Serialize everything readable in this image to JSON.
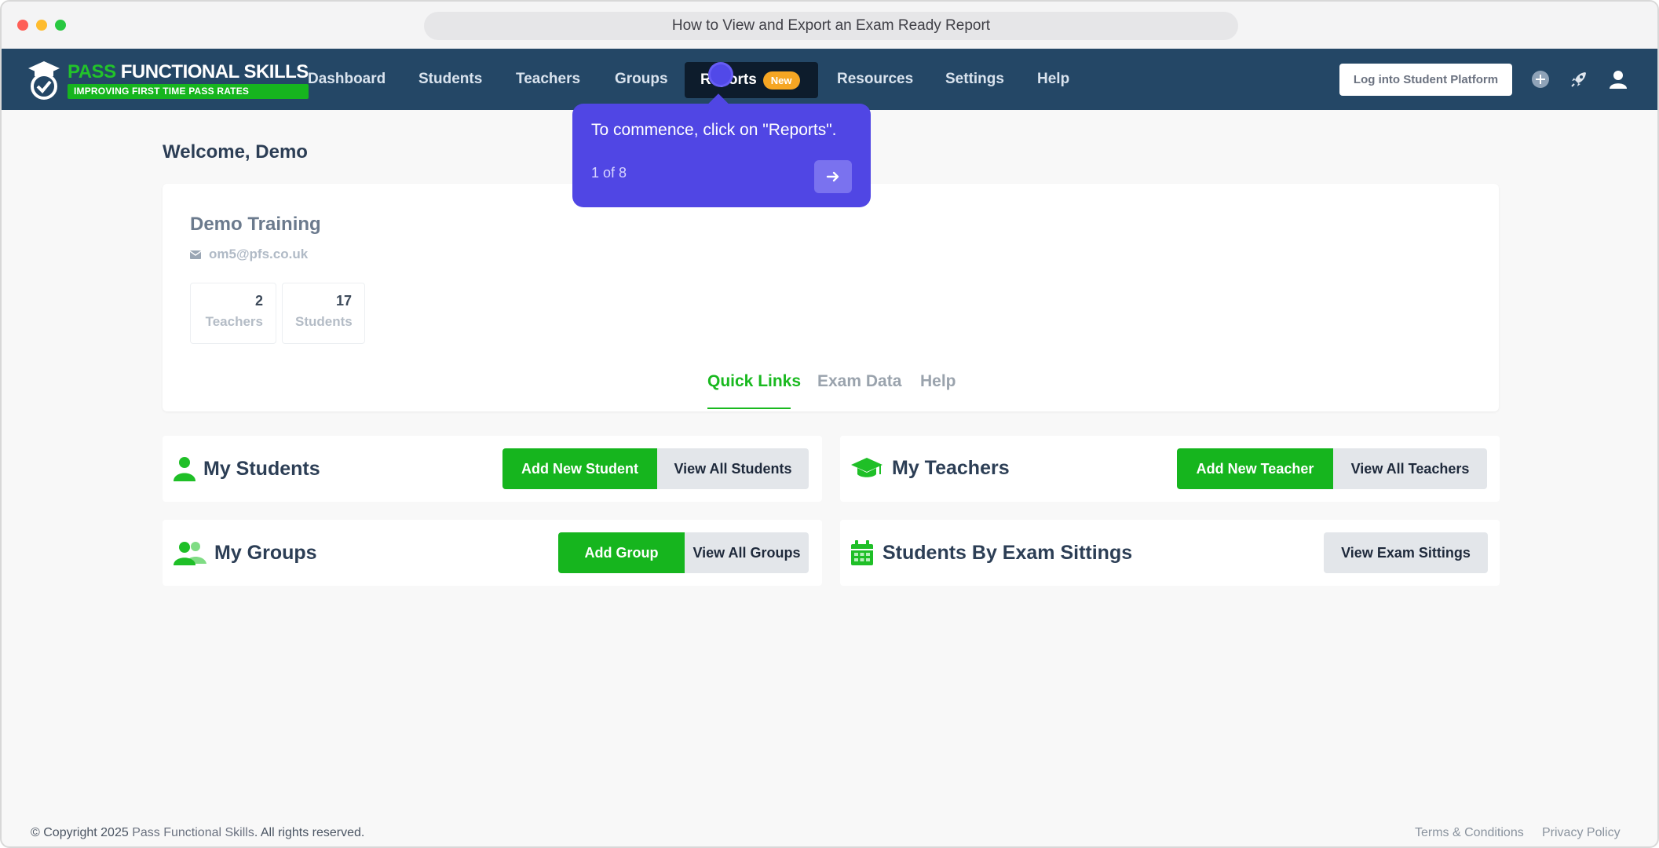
{
  "browser": {
    "url_title": "How to View and Export an Exam Ready Report"
  },
  "logo": {
    "title_accent": "PASS",
    "title_rest": "FUNCTIONAL SKILLS",
    "tagline": "IMPROVING FIRST TIME PASS RATES"
  },
  "nav": {
    "items": [
      "Dashboard",
      "Students",
      "Teachers",
      "Groups",
      "Reports",
      "Resources",
      "Settings",
      "Help"
    ],
    "reports_badge": "New",
    "login_label": "Log into Student Platform",
    "icons": [
      "plus-circle-icon",
      "rocket-icon",
      "user-icon"
    ]
  },
  "tooltip": {
    "text": "To commence, click on \"Reports\".",
    "step": "1 of 8"
  },
  "welcome": "Welcome, Demo",
  "profile": {
    "name": "Demo Training",
    "email": "om5@pfs.co.uk",
    "stats": [
      {
        "value": "2",
        "label": "Teachers"
      },
      {
        "value": "17",
        "label": "Students"
      }
    ]
  },
  "tabs": [
    "Quick Links",
    "Exam Data",
    "Help"
  ],
  "panels": {
    "students": {
      "title": "My Students",
      "primary": "Add New Student",
      "secondary": "View All Students"
    },
    "teachers": {
      "title": "My Teachers",
      "primary": "Add New Teacher",
      "secondary": "View All Teachers"
    },
    "groups": {
      "title": "My Groups",
      "primary": "Add Group",
      "secondary": "View All Groups"
    },
    "sittings": {
      "title": "Students By Exam Sittings",
      "secondary": "View Exam Sittings"
    }
  },
  "footer": {
    "copyright_prefix": "© Copyright 2025 ",
    "brand": "Pass Functional Skills",
    "copyright_suffix": ". All rights reserved.",
    "links": [
      "Terms & Conditions",
      "Privacy Policy"
    ]
  },
  "colors": {
    "navbar": "#244766",
    "accent_green": "#16b51e",
    "tooltip": "#5046e4",
    "badge": "#f6a623"
  }
}
